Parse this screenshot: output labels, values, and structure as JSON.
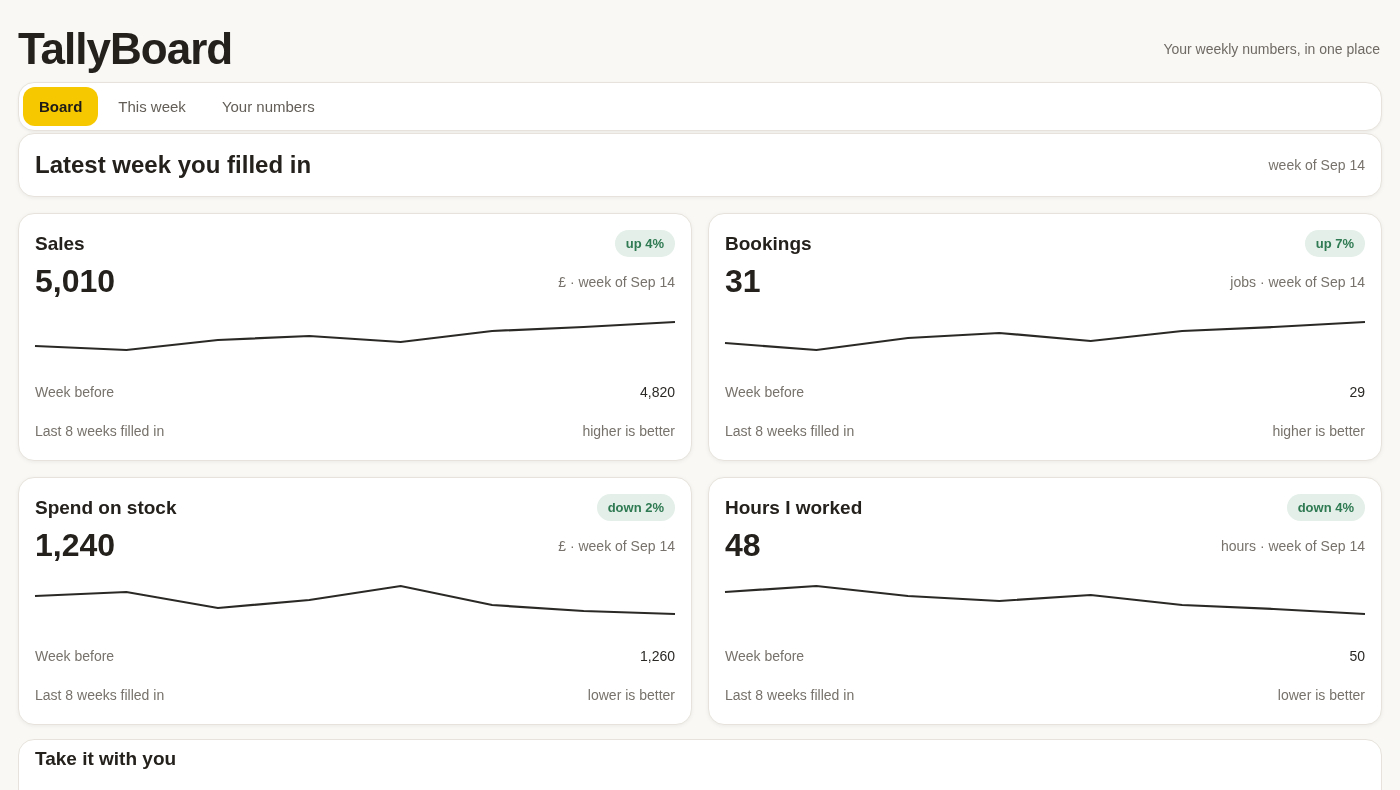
{
  "app": {
    "title": "TallyBoard",
    "tagline": "Your weekly numbers, in one place"
  },
  "tabs": [
    {
      "label": "Board",
      "selected": true
    },
    {
      "label": "This week",
      "selected": false
    },
    {
      "label": "Your numbers",
      "selected": false
    }
  ],
  "latest": {
    "title": "Latest week you filled in",
    "week": "week of Sep 14"
  },
  "cards": [
    {
      "title": "Sales",
      "change": "up 4%",
      "value": "5,010",
      "unit": "£ · week of Sep 14",
      "before_label": "Week before",
      "before_value": "4,820",
      "footer_label": "Last 8 weeks filled in",
      "direction": "higher is better"
    },
    {
      "title": "Bookings",
      "change": "up 7%",
      "value": "31",
      "unit": "jobs · week of Sep 14",
      "before_label": "Week before",
      "before_value": "29",
      "footer_label": "Last 8 weeks filled in",
      "direction": "higher is better"
    },
    {
      "title": "Spend on stock",
      "change": "down 2%",
      "value": "1,240",
      "unit": "£ · week of Sep 14",
      "before_label": "Week before",
      "before_value": "1,260",
      "footer_label": "Last 8 weeks filled in",
      "direction": "lower is better"
    },
    {
      "title": "Hours I worked",
      "change": "down 4%",
      "value": "48",
      "unit": "hours · week of Sep 14",
      "before_label": "Week before",
      "before_value": "50",
      "footer_label": "Last 8 weeks filled in",
      "direction": "lower is better"
    }
  ],
  "bottom": {
    "title": "Take it with you"
  }
}
